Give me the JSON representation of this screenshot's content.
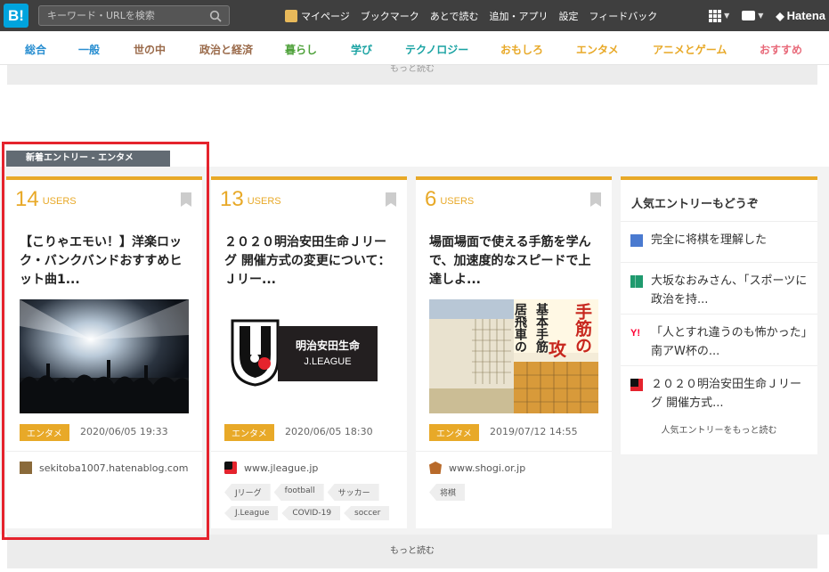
{
  "header": {
    "logo": "B!",
    "search_placeholder": "キーワード・URLを検索",
    "links": [
      "マイページ",
      "ブックマーク",
      "あとで読む",
      "追加・アプリ",
      "設定",
      "フィードバック"
    ],
    "brand": "Hatena"
  },
  "categories": [
    {
      "label": "総合",
      "color": "#2a8fd1"
    },
    {
      "label": "一般",
      "color": "#2a8fd1"
    },
    {
      "label": "世の中",
      "color": "#9a6a4a"
    },
    {
      "label": "政治と経済",
      "color": "#9a6a4a"
    },
    {
      "label": "暮らし",
      "color": "#4ea13a"
    },
    {
      "label": "学び",
      "color": "#1aa3a3"
    },
    {
      "label": "テクノロジー",
      "color": "#1aa3a3"
    },
    {
      "label": "おもしろ",
      "color": "#e8a928"
    },
    {
      "label": "エンタメ",
      "color": "#e8a928"
    },
    {
      "label": "アニメとゲーム",
      "color": "#e8a928"
    },
    {
      "label": "おすすめ",
      "color": "#e86a7a"
    }
  ],
  "more_top_label": "もっと読む",
  "section_label": "新着エントリー - エンタメ",
  "cards": [
    {
      "users": "14",
      "users_label": "USERS",
      "title": "【こりゃエモい！】洋楽ロック・バンクバンドおすすめヒット曲1...",
      "tag": "エンタメ",
      "date": "2020/06/05 19:33",
      "site": "sekitoba1007.hatenablog.com",
      "keywords": []
    },
    {
      "users": "13",
      "users_label": "USERS",
      "title": "２０２０明治安田生命Ｊリーグ 開催方式の変更について：Ｊリー...",
      "thumb_text": [
        "明治安田生命",
        "J.LEAGUE"
      ],
      "tag": "エンタメ",
      "date": "2020/06/05 18:30",
      "site": "www.jleague.jp",
      "keywords": [
        "Jリーグ",
        "football",
        "サッカー",
        "J.League",
        "COVID-19",
        "soccer"
      ]
    },
    {
      "users": "6",
      "users_label": "USERS",
      "title": "場面場面で使える手筋を学んで、加速度的なスピードで上達しよ...",
      "thumb_text": [
        "手筋の",
        "攻",
        "居飛車の",
        "基本手筋"
      ],
      "tag": "エンタメ",
      "date": "2019/07/12 14:55",
      "site": "www.shogi.or.jp",
      "keywords": [
        "将棋"
      ]
    }
  ],
  "popular": {
    "title": "人気エントリーもどうぞ",
    "items": [
      "完全に将棋を理解した",
      "大坂なおみさん、「スポーツに政治を持...",
      "「人とすれ違うのも怖かった」南アW杯の...",
      "２０２０明治安田生命Ｊリーグ 開催方式..."
    ],
    "more": "人気エントリーをもっと読む"
  },
  "more_bottom_label": "もっと読む"
}
